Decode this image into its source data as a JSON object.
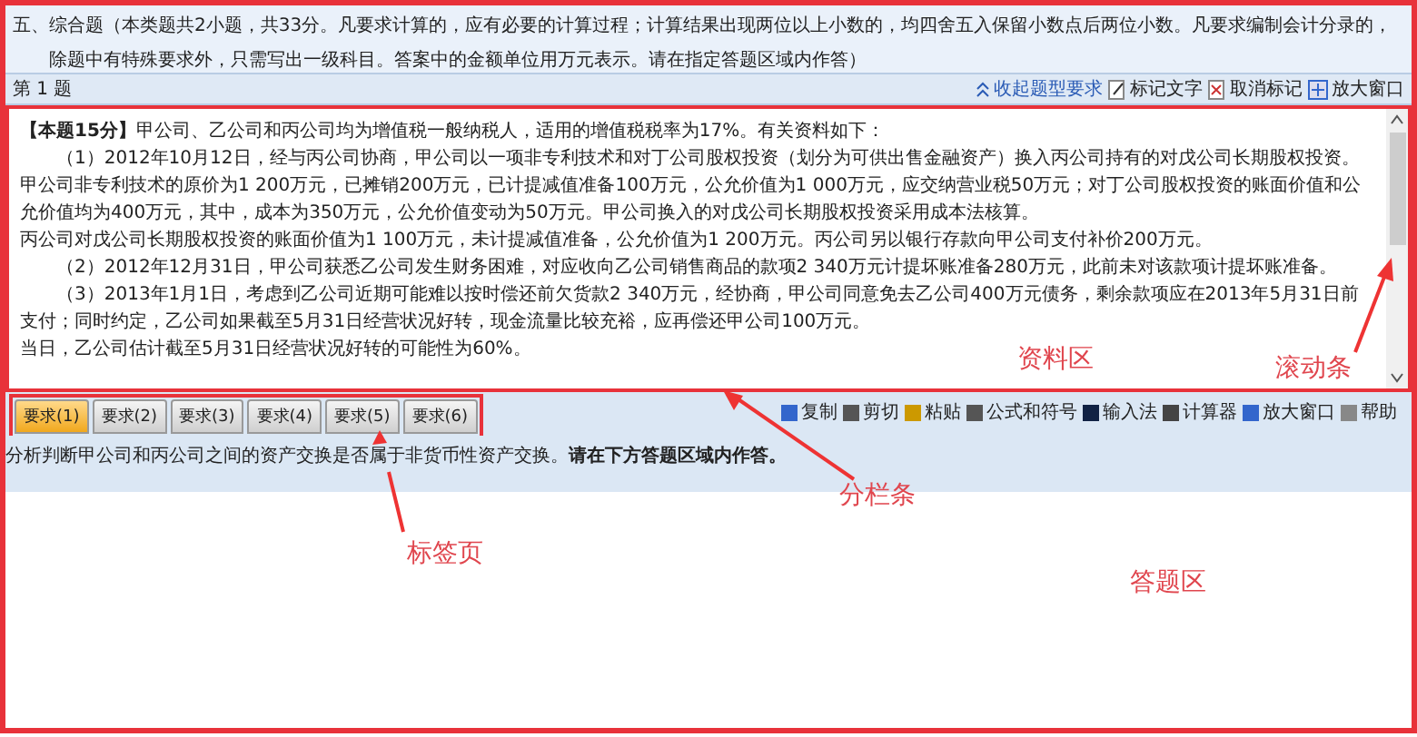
{
  "section_header": "五、综合题（本类题共2小题，共33分。凡要求计算的，应有必要的计算过程；计算结果出现两位以上小数的，均四舍五入保留小数点后两位小数。凡要求编制会计分录的，除题中有特殊要求外，只需写出一级科目。答案中的金额单位用万元表示。请在指定答题区域内作答）",
  "question_bar": {
    "title": "第 1 题",
    "tools": [
      {
        "kind": "collapse",
        "label": "收起题型要求"
      },
      {
        "kind": "mark",
        "label": "标记文字"
      },
      {
        "kind": "unmark",
        "label": "取消标记"
      },
      {
        "kind": "zoom",
        "label": "放大窗口"
      }
    ]
  },
  "material": [
    "**【本题15分】**甲公司、乙公司和丙公司均为增值税一般纳税人，适用的增值税税率为17%。有关资料如下：",
    "　　（1）2012年10月12日，经与丙公司协商，甲公司以一项非专利技术和对丁公司股权投资（划分为可供出售金融资产）换入丙公司持有的对戊公司长期股权投资。",
    "甲公司非专利技术的原价为1 200万元，已摊销200万元，已计提减值准备100万元，公允价值为1 000万元，应交纳营业税50万元；对丁公司股权投资的账面价值和公允价值均为400万元，其中，成本为350万元，公允价值变动为50万元。甲公司换入的对戊公司长期股权投资采用成本法核算。",
    "丙公司对戊公司长期股权投资的账面价值为1 100万元，未计提减值准备，公允价值为1 200万元。丙公司另以银行存款向甲公司支付补价200万元。",
    "　　（2）2012年12月31日，甲公司获悉乙公司发生财务困难，对应收向乙公司销售商品的款项2 340万元计提坏账准备280万元，此前未对该款项计提坏账准备。",
    "　　（3）2013年1月1日，考虑到乙公司近期可能难以按时偿还前欠货款2 340万元，经协商，甲公司同意免去乙公司400万元债务，剩余款项应在2013年5月31日前支付；同时约定，乙公司如果截至5月31日经营状况好转，现金流量比较充裕，应再偿还甲公司100万元。",
    "当日，乙公司估计截至5月31日经营状况好转的可能性为60%。"
  ],
  "tabs": [
    {
      "label": "要求(1)",
      "selected": true
    },
    {
      "label": "要求(2)",
      "selected": false
    },
    {
      "label": "要求(3)",
      "selected": false
    },
    {
      "label": "要求(4)",
      "selected": false
    },
    {
      "label": "要求(5)",
      "selected": false
    },
    {
      "label": "要求(6)",
      "selected": false
    }
  ],
  "answer_tools": [
    {
      "kind": "copy",
      "label": "复制"
    },
    {
      "kind": "cut",
      "label": "剪切"
    },
    {
      "kind": "paste",
      "label": "粘贴"
    },
    {
      "kind": "formula",
      "label": "公式和符号"
    },
    {
      "kind": "ime",
      "label": "输入法"
    },
    {
      "kind": "calculator",
      "label": "计算器"
    },
    {
      "kind": "zoom",
      "label": "放大窗口"
    },
    {
      "kind": "help",
      "label": "帮助"
    }
  ],
  "requirement": "分析判断甲公司和丙公司之间的资产交换是否属于非货币性资产交换。**请在下方答题区域内作答。**",
  "annotations": [
    {
      "text": "资料区"
    },
    {
      "text": "滚动条"
    },
    {
      "text": "分栏条"
    },
    {
      "text": "标签页"
    },
    {
      "text": "答题区"
    }
  ]
}
